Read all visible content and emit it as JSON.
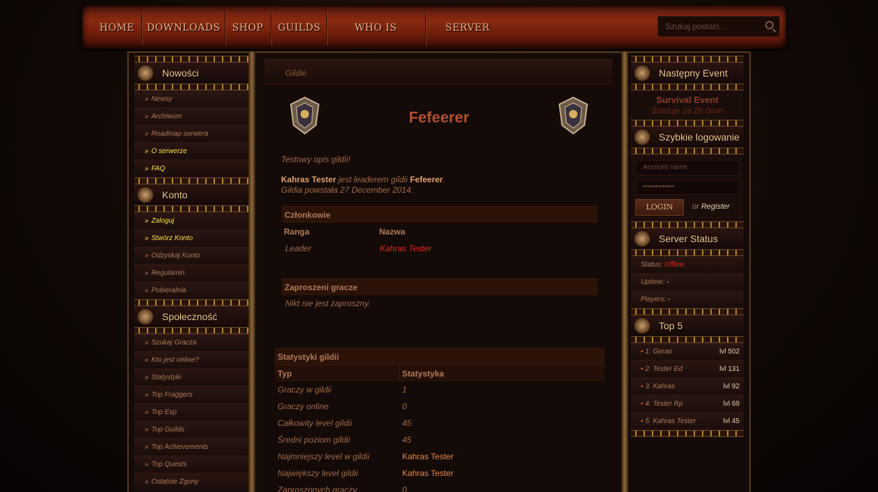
{
  "nav": {
    "items": [
      "HOME",
      "DOWNLOADS",
      "SHOP",
      "GUILDS",
      "WHO IS ONLINE?",
      "SERVER INFO"
    ],
    "search_placeholder": "Szukaj postaci..."
  },
  "left": {
    "sections": [
      {
        "title": "Nowości",
        "icon": "news-icon",
        "links": [
          {
            "label": "Newsy",
            "hi": false
          },
          {
            "label": "Archiwum",
            "hi": false
          },
          {
            "label": "Roadmap serwera",
            "hi": false
          },
          {
            "label": "O serwerze",
            "hi": true
          },
          {
            "label": "FAQ",
            "hi": true
          }
        ]
      },
      {
        "title": "Konto",
        "icon": "account-icon",
        "links": [
          {
            "label": "Zaloguj",
            "hi": true
          },
          {
            "label": "Stwórz Konto",
            "hi": true
          },
          {
            "label": "Odzyskaj Konto",
            "hi": false
          },
          {
            "label": "Regulamin",
            "hi": false
          },
          {
            "label": "Pobieralnia",
            "hi": false
          }
        ]
      },
      {
        "title": "Społeczność",
        "icon": "community-icon",
        "links": [
          {
            "label": "Szukaj Gracza",
            "hi": false
          },
          {
            "label": "Kto jest online?",
            "hi": false
          },
          {
            "label": "Statystyki",
            "hi": false
          },
          {
            "label": "Top Fraggers",
            "hi": false
          },
          {
            "label": "Top Exp",
            "hi": false
          },
          {
            "label": "Top Guilds",
            "hi": false
          },
          {
            "label": "Top Achievements",
            "hi": false
          },
          {
            "label": "Top Quests",
            "hi": false
          },
          {
            "label": "Ostatnie Zgony",
            "hi": false
          }
        ]
      }
    ]
  },
  "center": {
    "breadcrumb": "Gildie",
    "guild_name": "Fefeerer",
    "description": "Testowy opis gildii!",
    "leader_name": "Kahras Tester",
    "leader_text": " jest leaderem gildii ",
    "leader_guild": "Fefeerer",
    "leader_dot": ".",
    "founded": "Gildia powstała 27 December 2014.",
    "members": {
      "title": "Członkowie",
      "col_rank": "Ranga",
      "col_name": "Nazwa",
      "rows": [
        {
          "rank": "Leader",
          "name": "Kahras Tester"
        }
      ]
    },
    "invited": {
      "title": "Zaproszeni gracze",
      "empty": "Nikt nie jest zaproszny."
    },
    "stats": {
      "title": "Statystyki gildii",
      "col_type": "Typ",
      "col_stat": "Statystyka",
      "rows": [
        {
          "type": "Graczy w gildii",
          "value": "1"
        },
        {
          "type": "Graczy online",
          "value": "0"
        },
        {
          "type": "Całkowity level gildii",
          "value": "45"
        },
        {
          "type": "Średni poziom gildii",
          "value": "45"
        },
        {
          "type": "Najmniejszy level w gildii",
          "value": "Kahras Tester"
        },
        {
          "type": "Największy level gildii",
          "value": "Kahras Tester"
        },
        {
          "type": "Zaproszonych graczy",
          "value": "0"
        }
      ]
    }
  },
  "right": {
    "event": {
      "title": "Następny Event",
      "name": "Survival Event",
      "starts": "Startuje za 2h 0min"
    },
    "login": {
      "title": "Szybkie logowanie",
      "account_placeholder": "Account name",
      "password_placeholder": "•••••••••••••",
      "button": "LOGIN",
      "or": "or",
      "register": "Register"
    },
    "status": {
      "title": "Server Status",
      "status_label": "Status:",
      "status_value": "Offline",
      "uptime_label": "Uptime:",
      "uptime_value": "-",
      "players_label": "Players:",
      "players_value": "-"
    },
    "top": {
      "title": "Top 5",
      "rows": [
        {
          "label": "1. Geran",
          "lvl": "lvl 502"
        },
        {
          "label": "2. Tester Ed",
          "lvl": "lvl 131"
        },
        {
          "label": "3. Kahras",
          "lvl": "lvl 92"
        },
        {
          "label": "4. Tester Rp",
          "lvl": "lvl 69"
        },
        {
          "label": "5. Kahras Tester",
          "lvl": "lvl 45"
        }
      ]
    }
  }
}
